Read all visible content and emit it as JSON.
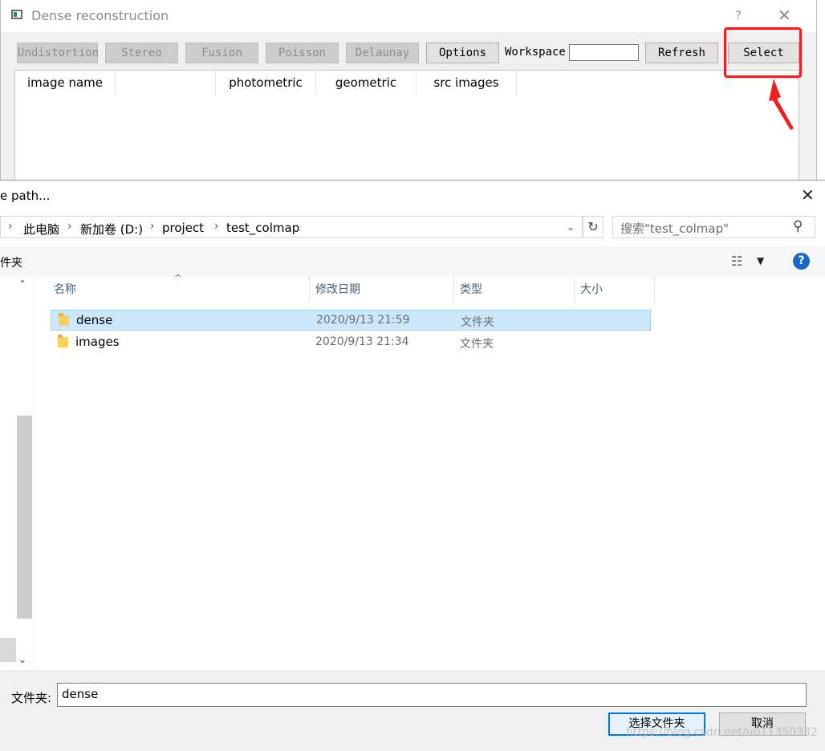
{
  "dense_window": {
    "title": "Dense reconstruction",
    "help": "?",
    "toolbar": {
      "undistortion": "Undistortion",
      "stereo": "Stereo",
      "fusion": "Fusion",
      "poisson": "Poisson",
      "delaunay": "Delaunay",
      "options": "Options",
      "workspace_label": "Workspace",
      "workspace_value": "",
      "refresh": "Refresh",
      "select": "Select"
    },
    "table_columns": [
      "image name",
      "",
      "photometric",
      "geometric",
      "src images"
    ]
  },
  "file_dialog": {
    "title": "e path...",
    "breadcrumb": [
      "此电脑",
      "新加卷 (D:)",
      "project",
      "test_colmap"
    ],
    "search_placeholder": "搜索\"test_colmap\"",
    "toolbar_label": "件夹",
    "columns": {
      "name": "名称",
      "modified": "修改日期",
      "type": "类型",
      "size": "大小"
    },
    "files": [
      {
        "name": "dense",
        "modified": "2020/9/13 21:59",
        "type": "文件夹",
        "selected": true
      },
      {
        "name": "images",
        "modified": "2020/9/13 21:34",
        "type": "文件夹",
        "selected": false
      }
    ],
    "folder_label": "文件夹:",
    "folder_value": "dense",
    "choose_button": "选择文件夹",
    "cancel_button": "取消"
  },
  "watermark": "https://blog.csdn.net/u011350332",
  "colors": {
    "annotation_red": "#f01e1e",
    "selection": "#cce8ff",
    "primary_border": "#0078d7",
    "help_blue": "#1a67c4"
  }
}
